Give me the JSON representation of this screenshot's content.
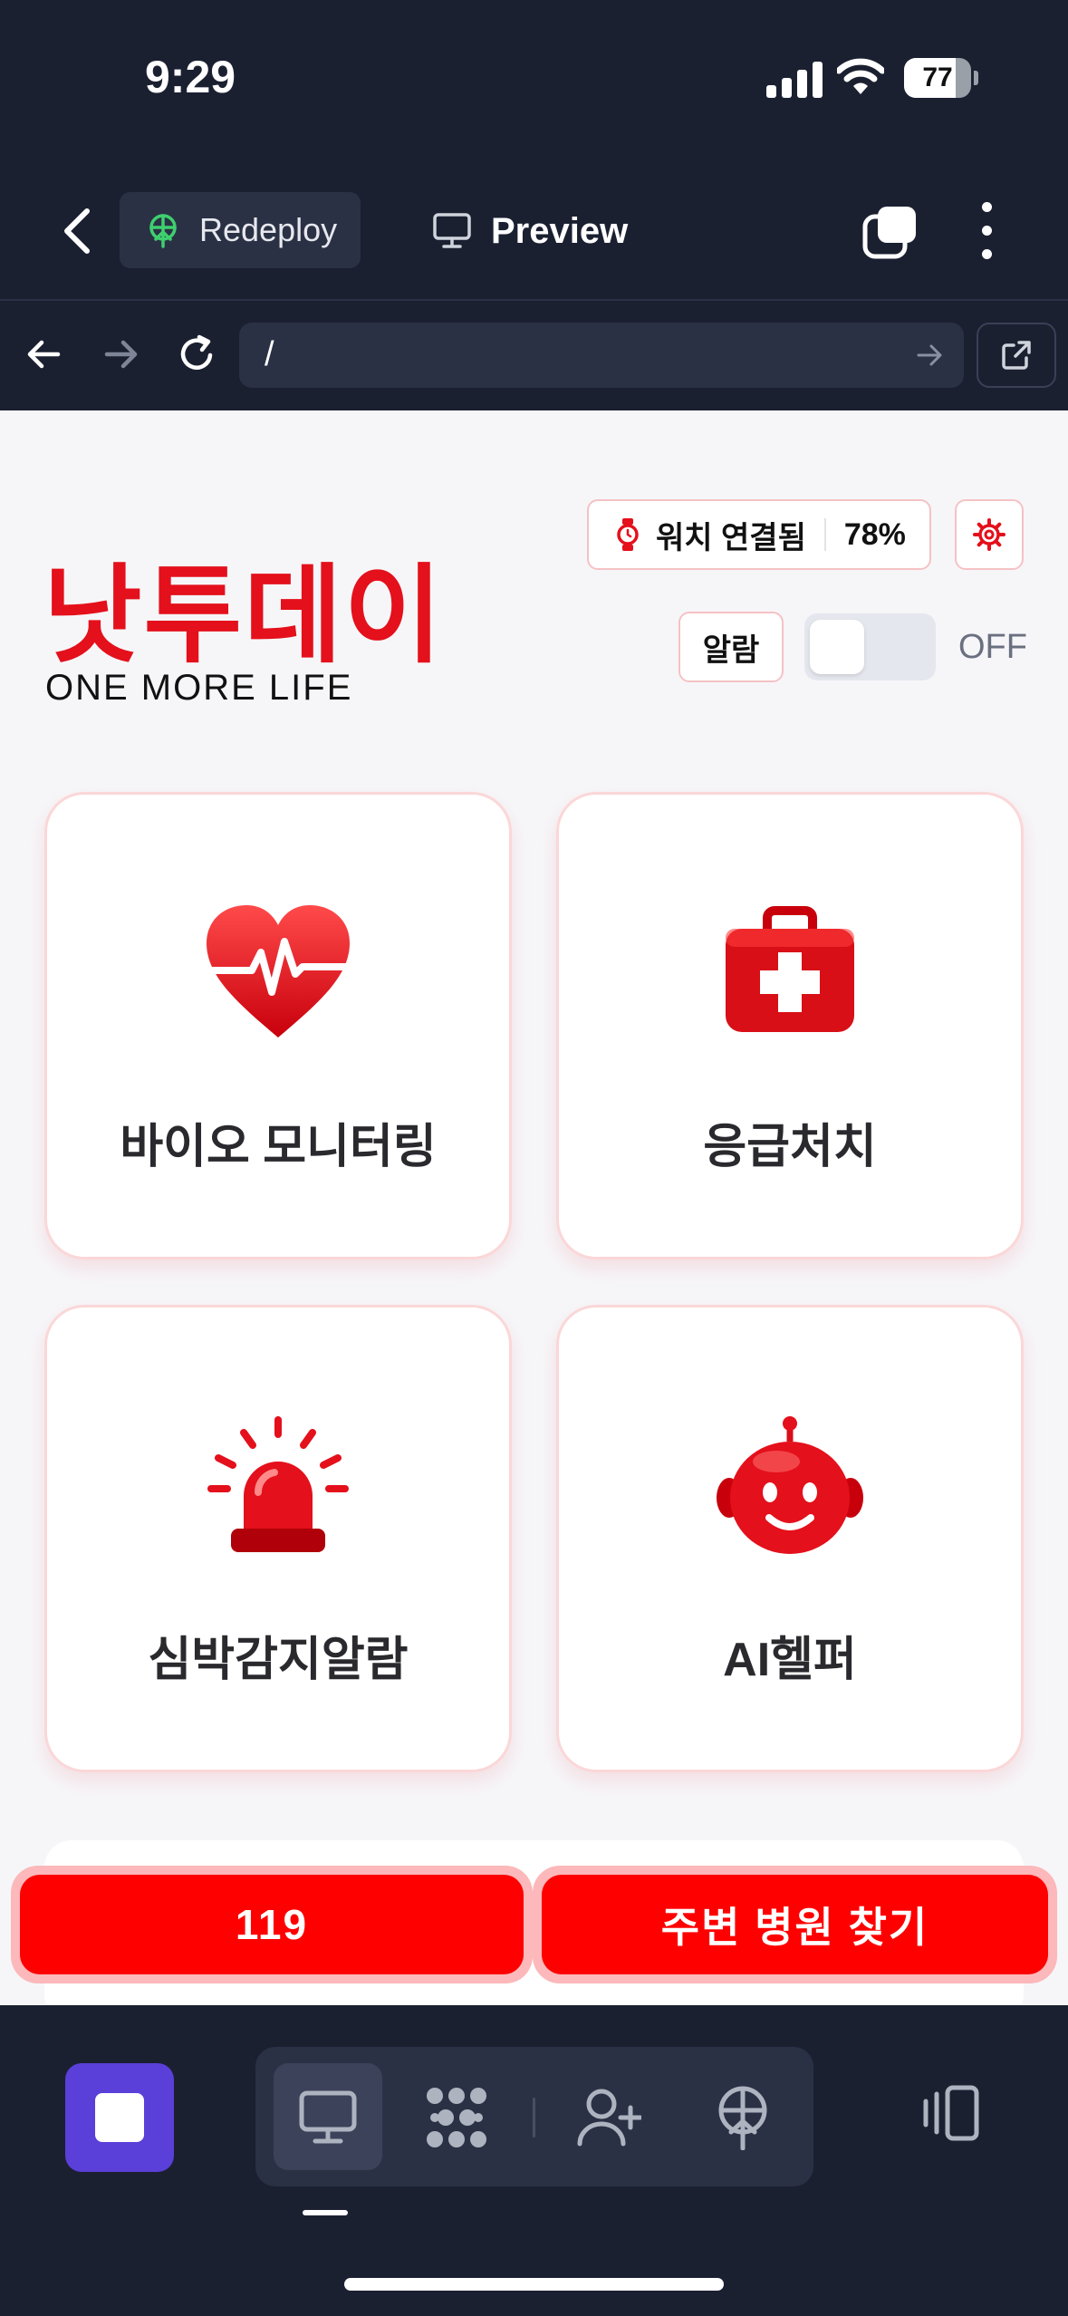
{
  "status_bar": {
    "time": "9:29",
    "battery_level": "77",
    "battery_fraction": 0.77
  },
  "app_header": {
    "redeploy_label": "Redeploy",
    "preview_label": "Preview"
  },
  "browser": {
    "url": "/"
  },
  "page": {
    "brand_title": "낫투데이",
    "brand_subtitle": "ONE MORE LIFE",
    "watch_status": "워치 연결됨",
    "watch_battery": "78%",
    "alarm_label": "알람",
    "alarm_state": "OFF",
    "alarm_on": false,
    "cards": [
      {
        "label": "바이오 모니터링",
        "icon": "heart-pulse-icon"
      },
      {
        "label": "응급처치",
        "icon": "first-aid-kit-icon"
      },
      {
        "label": "심박감지알람",
        "icon": "siren-icon"
      },
      {
        "label": "AI헬퍼",
        "icon": "robot-icon"
      }
    ],
    "actions": {
      "call_119": "119",
      "find_hospital": "주변 병원 찾기"
    }
  },
  "toolbar": {
    "tools": [
      "monitor-icon",
      "apps-grid-icon",
      "add-user-icon",
      "deploy-icon",
      "device-rotate-icon"
    ]
  },
  "colors": {
    "brand_red": "#e4101b",
    "action_red": "#ff0000",
    "chrome_bg": "#1b2031",
    "stop_purple": "#5a3fd8"
  }
}
